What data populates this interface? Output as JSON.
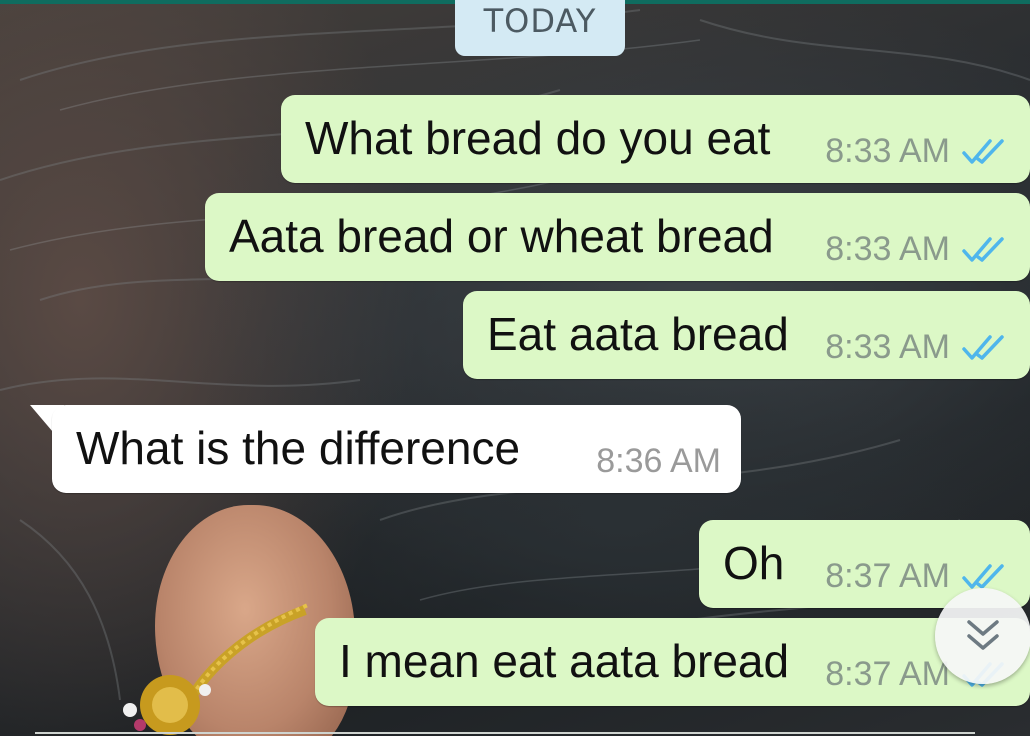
{
  "chat": {
    "date_divider": "TODAY",
    "messages": [
      {
        "direction": "outgoing",
        "text": "What bread do you eat",
        "time": "8:33 AM",
        "status": "read"
      },
      {
        "direction": "outgoing",
        "text": "Aata bread or wheat bread",
        "time": "8:33 AM",
        "status": "read"
      },
      {
        "direction": "outgoing",
        "text": "Eat aata bread",
        "time": "8:33 AM",
        "status": "read"
      },
      {
        "direction": "incoming",
        "text": "What is the difference",
        "time": "8:36 AM"
      },
      {
        "direction": "outgoing",
        "text": "Oh",
        "time": "8:37 AM",
        "status": "read"
      },
      {
        "direction": "outgoing",
        "text": "I mean eat aata bread",
        "time": "8:37 AM",
        "status": "read"
      }
    ]
  },
  "controls": {
    "scroll_to_bottom_icon": "double-chevron-down-icon"
  },
  "colors": {
    "outgoing_bubble": "#dcf8c6",
    "incoming_bubble": "#ffffff",
    "date_chip": "#d4eaf4",
    "read_ticks": "#4fb6ec",
    "header_accent": "#0f6c5f"
  }
}
